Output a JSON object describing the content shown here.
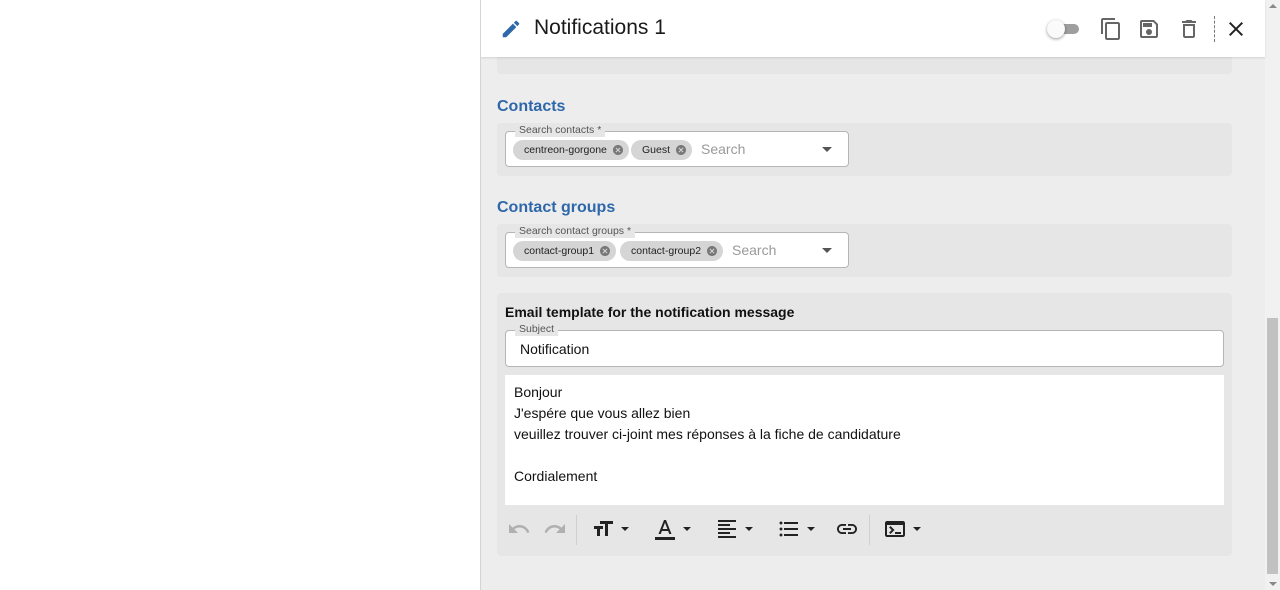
{
  "header": {
    "title": "Notifications 1",
    "actions": [
      "copy-icon",
      "save-icon",
      "delete-icon",
      "close-icon"
    ]
  },
  "contacts": {
    "section_title": "Contacts",
    "field_label": "Search contacts *",
    "chips": [
      "centreon-gorgone",
      "Guest"
    ],
    "placeholder": "Search"
  },
  "contact_groups": {
    "section_title": "Contact groups",
    "field_label": "Search contact groups *",
    "chips": [
      "contact-group1",
      "contact-group2"
    ],
    "placeholder": "Search"
  },
  "email": {
    "section_title": "Email template for the notification message",
    "subject_label": "Subject",
    "subject_value": "Notification",
    "body_lines": [
      "Bonjour",
      "J'espére que vous allez bien",
      "veuillez trouver ci-joint mes réponses à la fiche de candidature",
      "",
      "Cordialement"
    ]
  },
  "colors": {
    "accent": "#2e68aa",
    "panel_bg": "#ededed",
    "card_bg": "#e6e6e6"
  }
}
